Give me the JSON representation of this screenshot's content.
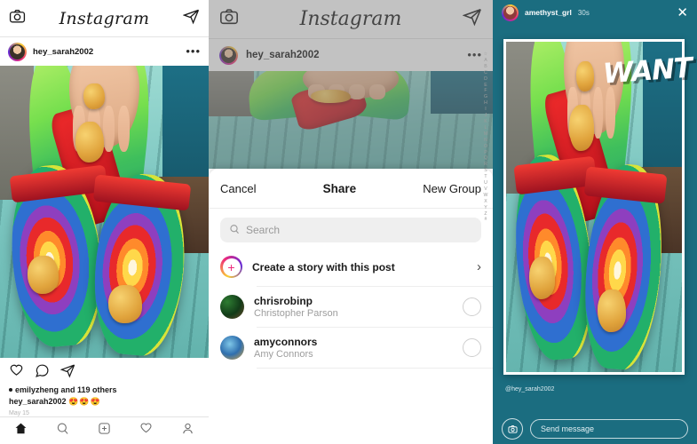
{
  "feed": {
    "app_title": "Instagram",
    "camera_icon": "camera-icon",
    "direct_icon": "direct-message-icon",
    "post": {
      "username": "hey_sarah2002",
      "more_label": "•••",
      "like_icon": "heart-icon",
      "comment_icon": "comment-icon",
      "share_icon": "share-icon",
      "likes_text": "emilyzheng and 119 others",
      "caption_user": "hey_sarah2002",
      "caption_emoji": "😍😍😍",
      "date": "May 15"
    },
    "tabs": [
      {
        "name": "home-tab",
        "icon": "home-icon"
      },
      {
        "name": "search-tab",
        "icon": "search-icon"
      },
      {
        "name": "add-post-tab",
        "icon": "plus-square-icon"
      },
      {
        "name": "activity-tab",
        "icon": "heart-icon"
      },
      {
        "name": "profile-tab",
        "icon": "person-icon"
      }
    ]
  },
  "share": {
    "app_title": "Instagram",
    "post_username": "hey_sarah2002",
    "more_label": "•••",
    "cancel_label": "Cancel",
    "title": "Share",
    "new_group_label": "New Group",
    "search_placeholder": "Search",
    "search_value": "",
    "create_story_label": "Create a story with this post",
    "chevron": "›",
    "recipients": [
      {
        "username": "chrisrobinp",
        "fullname": "Christopher Parson"
      },
      {
        "username": "amyconnors",
        "fullname": "Amy Connors"
      }
    ],
    "alpha_index": [
      "☆",
      "A",
      "B",
      "C",
      "D",
      "E",
      "F",
      "G",
      "H",
      "I",
      "J",
      "K",
      "L",
      "M",
      "N",
      "O",
      "P",
      "Q",
      "R",
      "S",
      "T",
      "U",
      "V",
      "W",
      "X",
      "Y",
      "Z",
      "#"
    ]
  },
  "story": {
    "username": "amethyst_grl",
    "timestamp": "30s",
    "close_label": "✕",
    "sticker_text": "WANT",
    "credit": "@hey_sarah2002",
    "camera_icon": "camera-icon",
    "message_placeholder": "Send message",
    "background_color": "#1b6d80"
  }
}
